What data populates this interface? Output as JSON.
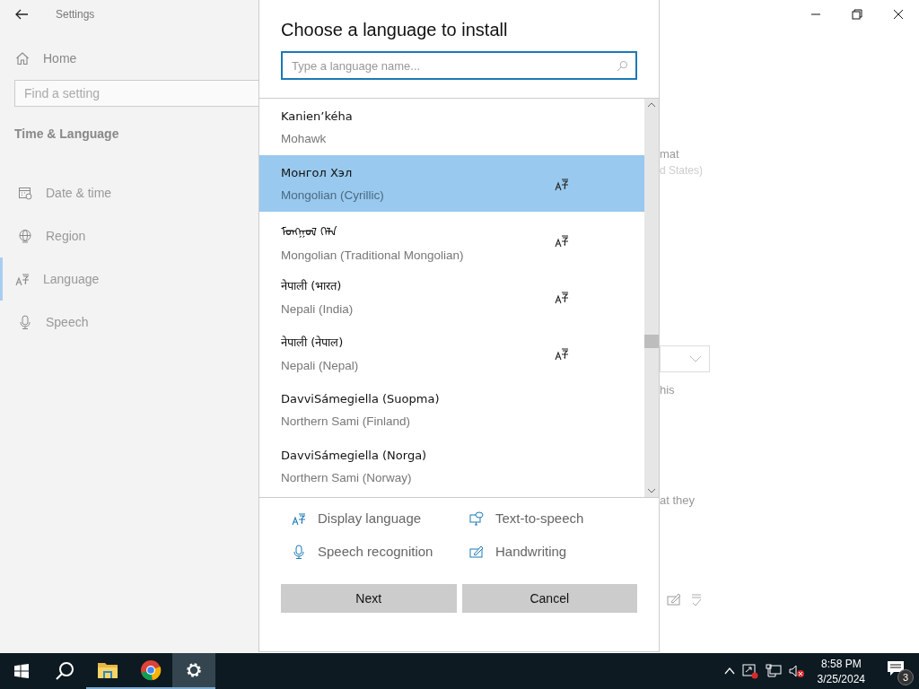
{
  "window": {
    "title": "Settings"
  },
  "sidebar": {
    "home": "Home",
    "search_placeholder": "Find a setting",
    "section": "Time & Language",
    "items": [
      {
        "label": "Date & time",
        "kind": "calendar",
        "selected": false
      },
      {
        "label": "Region",
        "kind": "globe",
        "selected": false
      },
      {
        "label": "Language",
        "kind": "language",
        "selected": true
      },
      {
        "label": "Speech",
        "kind": "mic",
        "selected": false
      }
    ]
  },
  "background": [
    {
      "kind": "text",
      "text": "mat"
    },
    {
      "kind": "subtext",
      "text": "d States)"
    },
    {
      "kind": "dropdown"
    },
    {
      "kind": "text",
      "text": "his"
    },
    {
      "kind": "text",
      "text": "at they"
    },
    {
      "kind": "icons"
    }
  ],
  "dialog": {
    "title": "Choose a language to install",
    "search_placeholder": "Type a language name...",
    "languages": [
      {
        "native": "Kanien’kéha",
        "english": "Mohawk",
        "display_language": false,
        "selected": false
      },
      {
        "native": "Монгол Хэл",
        "english": "Mongolian (Cyrillic)",
        "display_language": true,
        "selected": true
      },
      {
        "native": "ᠮᠣᠩᠭᠣᠯ ᠬᠡᠯᠡ",
        "english": "Mongolian (Traditional Mongolian)",
        "display_language": true,
        "selected": false
      },
      {
        "native": "नेपाली (भारत)",
        "english": "Nepali (India)",
        "display_language": true,
        "selected": false
      },
      {
        "native": "नेपाली (नेपाल)",
        "english": "Nepali (Nepal)",
        "display_language": true,
        "selected": false
      },
      {
        "native": "DavviSámegiella (Suopma)",
        "english": "Northern Sami (Finland)",
        "display_language": false,
        "selected": false
      },
      {
        "native": "DavviSámegiella (Norga)",
        "english": "Northern Sami (Norway)",
        "display_language": false,
        "selected": false
      }
    ],
    "features": [
      {
        "kind": "display",
        "label": "Display language"
      },
      {
        "kind": "tts",
        "label": "Text-to-speech"
      },
      {
        "kind": "speech",
        "label": "Speech recognition"
      },
      {
        "kind": "handwriting",
        "label": "Handwriting"
      }
    ],
    "buttons": [
      "Next",
      "Cancel"
    ]
  },
  "taskbar": {
    "apps": [
      {
        "kind": "explorer",
        "active": false
      },
      {
        "kind": "chrome",
        "active": false
      },
      {
        "kind": "settings",
        "active": true
      }
    ],
    "time": "8:58 PM",
    "date": "3/25/2024",
    "notifications": "3"
  }
}
